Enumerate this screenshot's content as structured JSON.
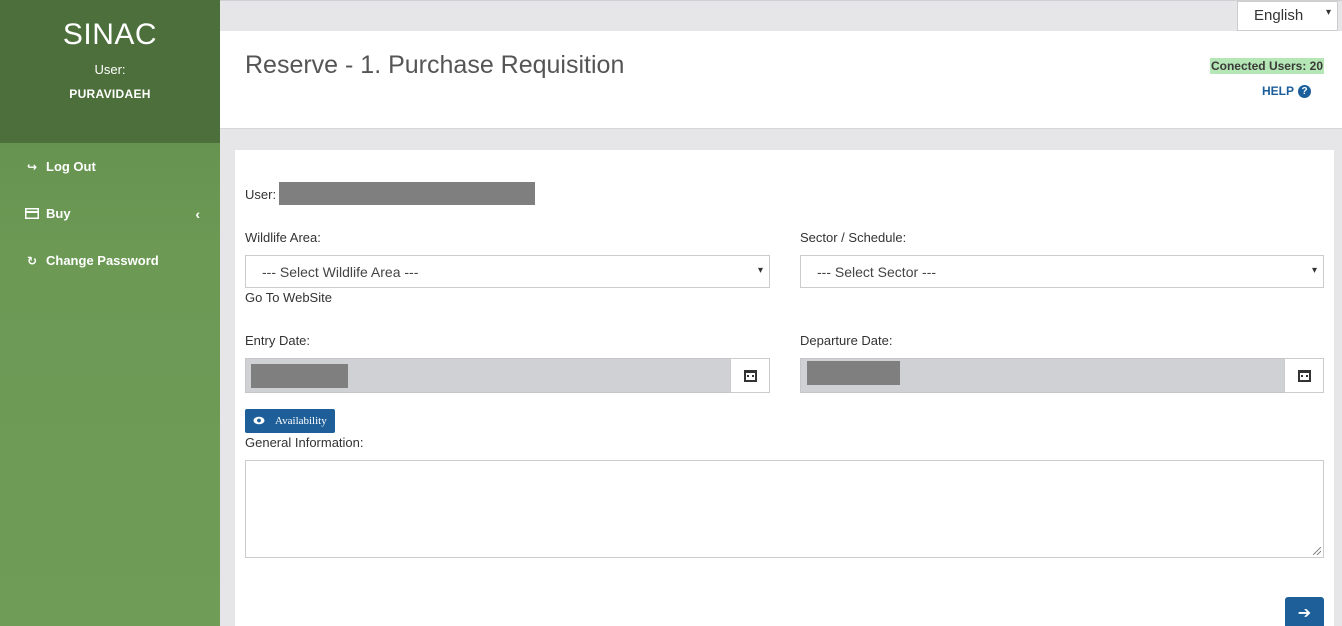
{
  "sidebar": {
    "brand": "SINAC",
    "user_label": "User:",
    "user_name": "PURAVIDAEH",
    "items": [
      {
        "label": "Log Out",
        "icon": "sign-out-icon",
        "glyph": "↪"
      },
      {
        "label": "Buy",
        "icon": "credit-card-icon",
        "glyph": "▬",
        "chevron": "‹"
      },
      {
        "label": "Change Password",
        "icon": "refresh-icon",
        "glyph": "↻"
      }
    ]
  },
  "topbar": {
    "language": "English",
    "caret": "▾"
  },
  "header": {
    "title": "Reserve - 1. Purchase Requisition",
    "connected_users": "Conected Users: 20",
    "help": "HELP",
    "help_glyph": "?"
  },
  "form": {
    "user_label": "User:",
    "wildlife_area_label": "Wildlife Area:",
    "wildlife_area_value": "--- Select Wildlife Area ---",
    "go_to_website": "Go To WebSite",
    "sector_label": "Sector / Schedule:",
    "sector_value": "--- Select Sector ---",
    "entry_date_label": "Entry Date:",
    "departure_date_label": "Departure Date:",
    "availability_button": "Availability",
    "general_info_label": "General Information:",
    "next_glyph": "➔"
  },
  "colors": {
    "sidebar_green": "#6c9a55",
    "sidebar_header": "#4d6f3c",
    "primary_blue": "#1e5f9a",
    "connected_bg": "#b5e6b5"
  }
}
